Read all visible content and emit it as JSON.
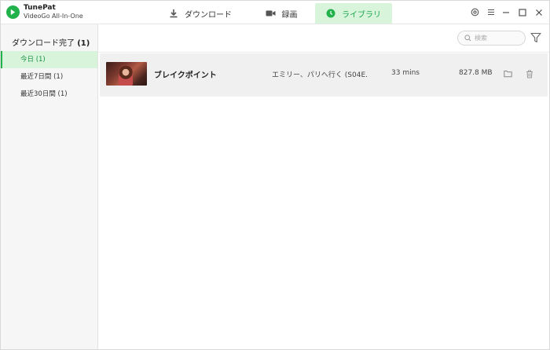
{
  "app": {
    "name": "TunePat",
    "subtitle": "VideoGo All-In-One"
  },
  "tabs": [
    {
      "label": "ダウンロード",
      "icon": "download-icon"
    },
    {
      "label": "録画",
      "icon": "camera-icon"
    },
    {
      "label": "ライブラリ",
      "icon": "clock-icon",
      "active": true
    }
  ],
  "sidebar": {
    "heading": "ダウンロード完了",
    "heading_count": "(1)",
    "items": [
      {
        "label": "今日 (1)",
        "active": true
      },
      {
        "label": "最近7日間 (1)"
      },
      {
        "label": "最近30日間 (1)"
      }
    ]
  },
  "search": {
    "placeholder": "検索"
  },
  "rows": [
    {
      "title": "ブレイクポイント",
      "episode": "エミリー、パリへ行く (S04E...",
      "duration": "33 mins",
      "size": "827.8 MB"
    }
  ],
  "colors": {
    "accent": "#22b24c",
    "accent_bg": "#d8f5dc"
  }
}
